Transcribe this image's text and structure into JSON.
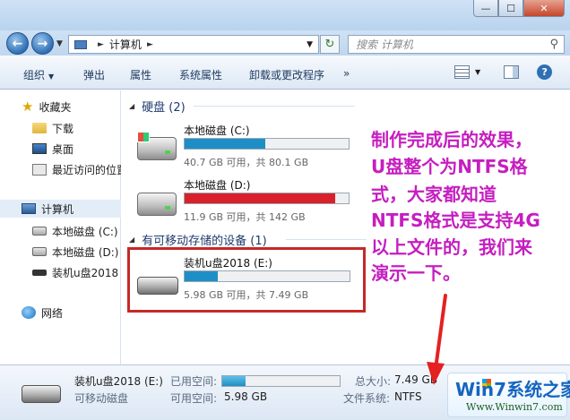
{
  "window": {
    "controls": {
      "minimize": "—",
      "maximize": "☐",
      "close": "✕"
    }
  },
  "nav": {
    "back_icon": "back-arrow-icon",
    "forward_icon": "forward-arrow-icon",
    "address": "计算机",
    "search_placeholder": "搜索 计算机"
  },
  "toolbar": {
    "items": [
      "组织",
      "弹出",
      "属性",
      "系统属性",
      "卸载或更改程序",
      "»"
    ]
  },
  "sidebar": {
    "favorites": {
      "label": "收藏夹",
      "items": [
        "下载",
        "桌面",
        "最近访问的位置"
      ]
    },
    "computer": {
      "label": "计算机",
      "items": [
        "本地磁盘 (C:)",
        "本地磁盘 (D:)",
        "装机u盘2018"
      ]
    },
    "network": {
      "label": "网络"
    }
  },
  "content": {
    "hdd_group": {
      "title": "硬盘 (2)"
    },
    "drives": [
      {
        "name": "本地磁盘 (C:)",
        "space": "40.7 GB 可用，共 80.1 GB",
        "used_fraction": 0.49,
        "color": "#1e8fc6"
      },
      {
        "name": "本地磁盘 (D:)",
        "space": "11.9 GB 可用，共 142 GB",
        "used_fraction": 0.92,
        "color": "#d8212a"
      }
    ],
    "removable_group": {
      "title": "有可移动存储的设备 (1)"
    },
    "usb": {
      "name": "装机u盘2018 (E:)",
      "space": "5.98 GB 可用，共 7.49 GB",
      "used_fraction": 0.2,
      "color": "#1e8fc6"
    }
  },
  "annotation": {
    "lines": [
      "制作完成后的效果，",
      "U盘整个为NTFS格",
      "式，大家都知道",
      "NTFS格式是支持4G",
      "以上文件的，我们来",
      "演示一下。"
    ],
    "color": "#c51ec0"
  },
  "details": {
    "name": "装机u盘2018 (E:)",
    "type": "可移动磁盘",
    "used_label": "已用空间:",
    "free_label": "可用空间:",
    "free_value": "5.98 GB",
    "total_label": "总大小:",
    "total_value": "7.49 GB",
    "fs_label": "文件系统:",
    "fs_value": "NTFS",
    "used_fraction": 0.2
  },
  "watermark": {
    "text": "Win7系统之家",
    "url": "Www.Winwin7.com"
  }
}
